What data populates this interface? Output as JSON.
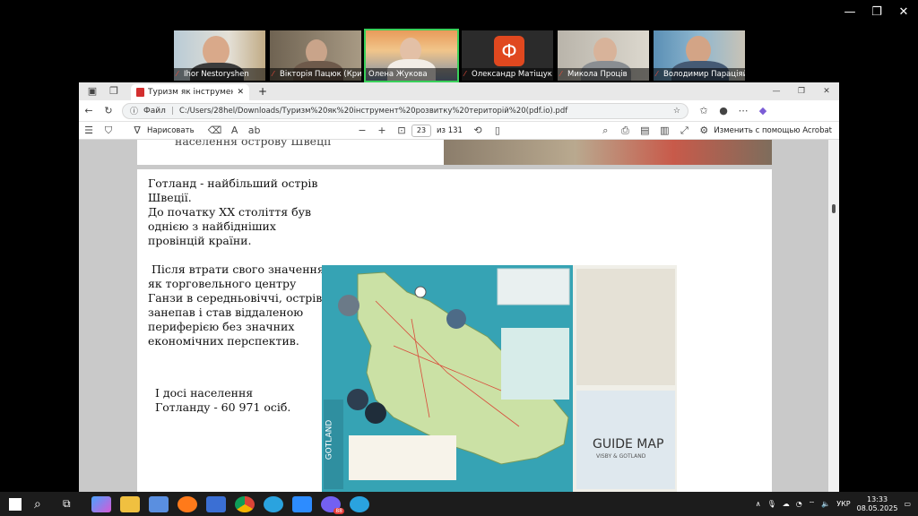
{
  "meeting": {
    "participants": [
      {
        "name": "Ihor Nestoryshen",
        "muted": true,
        "active": false
      },
      {
        "name": "Вікторія Пацюк (Крив...",
        "muted": true,
        "active": false
      },
      {
        "name": "Олена Жукова",
        "muted": false,
        "active": true
      },
      {
        "name": "Олександр Матіщук",
        "muted": true,
        "active": false,
        "avatar_letter": "Ф"
      },
      {
        "name": "Микола Проців",
        "muted": true,
        "active": false
      },
      {
        "name": "Володимир Параціяй",
        "muted": true,
        "active": false
      }
    ]
  },
  "browser": {
    "tab_title": "Туризм як інструмент розвитку",
    "address_prefix": "Файл",
    "url": "C:/Users/28hel/Downloads/Туризм%20як%20інструмент%20розвитку%20територій%20(pdf.io).pdf",
    "pdf_toolbar": {
      "draw_label": "Нарисовать",
      "page_current": "23",
      "page_total": "из 131",
      "acrobat_label": "Изменить с помощью Acrobat"
    }
  },
  "document": {
    "prev_page_fragment": "населення острову Швеції",
    "paragraph1": [
      "Готланд - найбільший острів",
      "Швеції.",
      "До початку ХХ століття був",
      "однією з найбідніших",
      "провінцій країни."
    ],
    "paragraph2": [
      "Після втрати свого значення",
      "як торговельного центру",
      "Ганзи в середньовіччі, острів",
      "занепав і став віддаленою",
      "периферією без значних",
      "економічних перспектив."
    ],
    "paragraph3": [
      "І досі населення",
      "Готланду - 60 971 осіб."
    ],
    "map_labels": {
      "island": "GOTLAND",
      "guide_title": "GUIDE MAP",
      "guide_sub": "VISBY & GOTLAND"
    }
  },
  "taskbar": {
    "language": "УКР",
    "time": "13:33",
    "date": "08.05.2025",
    "badge_count": "88"
  }
}
